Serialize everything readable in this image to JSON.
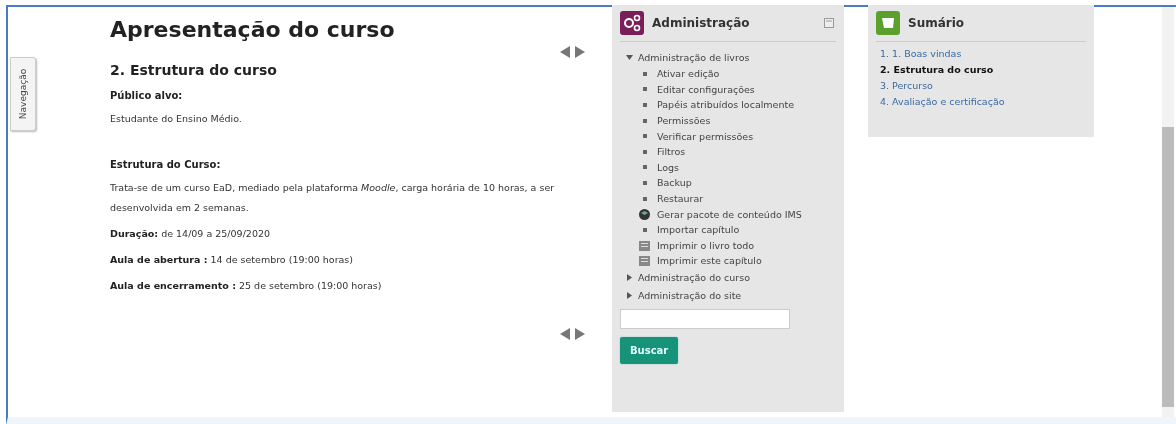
{
  "nav_tab": {
    "label": "Navegação"
  },
  "content": {
    "title": "Apresentação do curso",
    "section_title": "2. Estrutura do curso",
    "paragraphs": [
      {
        "kind": "label",
        "text": "Público alvo:"
      },
      {
        "kind": "text",
        "text": "Estudante do Ensino Médio."
      },
      {
        "kind": "spacer"
      },
      {
        "kind": "label",
        "text": "Estrutura do Curso:"
      },
      {
        "kind": "text",
        "text": "Trata-se de um curso EaD, mediado pela plataforma *Moodle*, carga horária de 10 horas, a ser desenvolvida em 2 semanas."
      },
      {
        "kind": "text",
        "text": "**Duração:** de 14/09 a 25/09/2020"
      },
      {
        "kind": "text",
        "text": "**Aula de abertura :** 14 de setembro (19:00 horas)"
      },
      {
        "kind": "text",
        "text": "**Aula de encerramento :** 25 de setembro (19:00 horas)"
      }
    ]
  },
  "administration": {
    "title": "Administração",
    "tree": [
      {
        "label": "Administração de livros",
        "expanded": true,
        "children": [
          {
            "label": "Ativar edição",
            "kind": "bullet"
          },
          {
            "label": "Editar configurações",
            "kind": "bullet"
          },
          {
            "label": "Papéis atribuídos localmente",
            "kind": "bullet"
          },
          {
            "label": "Permissões",
            "kind": "bullet"
          },
          {
            "label": "Verificar permissões",
            "kind": "bullet"
          },
          {
            "label": "Filtros",
            "kind": "bullet"
          },
          {
            "label": "Logs",
            "kind": "bullet"
          },
          {
            "label": "Backup",
            "kind": "bullet"
          },
          {
            "label": "Restaurar",
            "kind": "bullet"
          },
          {
            "label": "Gerar pacote de conteúdo IMS",
            "kind": "package"
          },
          {
            "label": "Importar capítulo",
            "kind": "bullet"
          },
          {
            "label": "Imprimir o livro todo",
            "kind": "print"
          },
          {
            "label": "Imprimir este capítulo",
            "kind": "print"
          }
        ]
      },
      {
        "label": "Administração do curso",
        "expanded": false
      },
      {
        "label": "Administração do site",
        "expanded": false
      }
    ],
    "search_button": "Buscar"
  },
  "summary": {
    "title": "Sumário",
    "items": [
      {
        "label": "1. 1. Boas vindas",
        "selected": false
      },
      {
        "label": "2. Estrutura do curso",
        "selected": true
      },
      {
        "label": "3. Percurso",
        "selected": false
      },
      {
        "label": "4. Avaliação e certificação",
        "selected": false
      }
    ]
  }
}
